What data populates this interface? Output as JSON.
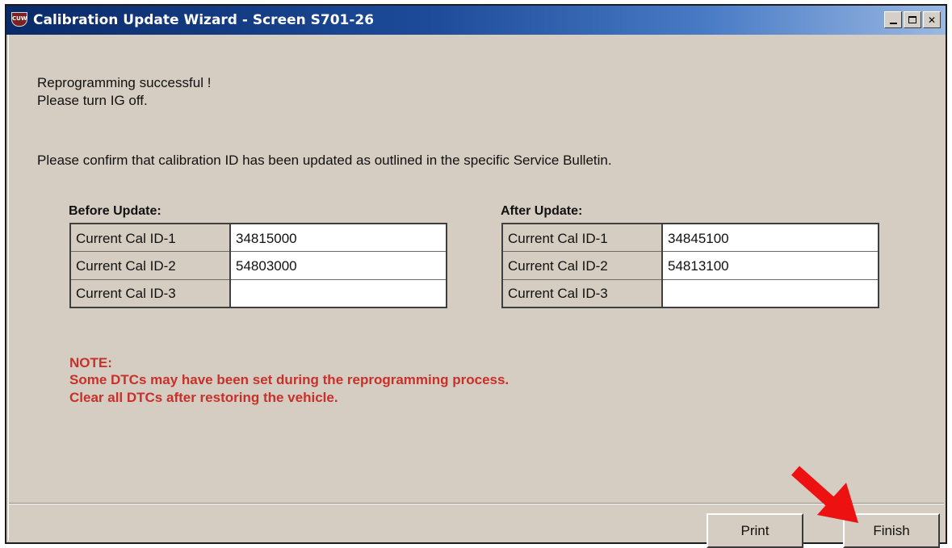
{
  "window": {
    "title": "Calibration Update Wizard - Screen S701-26",
    "icon_label": "CUW",
    "controls": {
      "minimize": "minimize",
      "maximize": "maximize",
      "close": "✕"
    }
  },
  "messages": {
    "line1": "Reprogramming successful !",
    "line2": "Please turn IG off.",
    "confirm": "Please confirm that calibration ID has been updated as outlined in the specific Service Bulletin."
  },
  "before": {
    "heading": "Before Update:",
    "rows": [
      {
        "label": "Current Cal ID-1",
        "value": "34815000"
      },
      {
        "label": "Current Cal ID-2",
        "value": "54803000"
      },
      {
        "label": "Current Cal ID-3",
        "value": ""
      }
    ]
  },
  "after": {
    "heading": "After Update:",
    "rows": [
      {
        "label": "Current Cal ID-1",
        "value": "34845100"
      },
      {
        "label": "Current Cal ID-2",
        "value": "54813100"
      },
      {
        "label": "Current Cal ID-3",
        "value": ""
      }
    ]
  },
  "note": {
    "heading": "NOTE:",
    "line1": "Some DTCs may have been set during the reprogramming process.",
    "line2": "Clear all DTCs after restoring the vehicle."
  },
  "buttons": {
    "print": "Print",
    "finish": "Finish"
  },
  "colors": {
    "note_red": "#c8302a",
    "arrow_red": "#ee1111",
    "panel": "#d5cdc1"
  },
  "annotation": {
    "arrow_icon": "red-arrow-icon"
  }
}
